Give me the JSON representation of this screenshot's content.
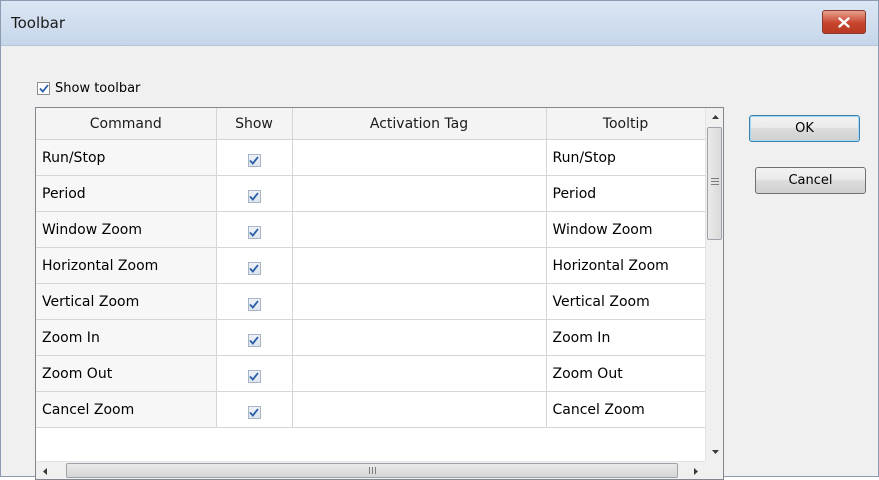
{
  "window": {
    "title": "Toolbar"
  },
  "show_toolbar": {
    "label": "Show toolbar",
    "checked": true
  },
  "grid": {
    "columns": [
      "Command",
      "Show",
      "Activation Tag",
      "Tooltip"
    ],
    "rows": [
      {
        "command": "Run/Stop",
        "show": true,
        "activation_tag": "",
        "tooltip": "Run/Stop"
      },
      {
        "command": "Period",
        "show": true,
        "activation_tag": "",
        "tooltip": "Period"
      },
      {
        "command": "Window Zoom",
        "show": true,
        "activation_tag": "",
        "tooltip": "Window Zoom"
      },
      {
        "command": "Horizontal Zoom",
        "show": true,
        "activation_tag": "",
        "tooltip": "Horizontal Zoom"
      },
      {
        "command": "Vertical Zoom",
        "show": true,
        "activation_tag": "",
        "tooltip": "Vertical Zoom"
      },
      {
        "command": "Zoom In",
        "show": true,
        "activation_tag": "",
        "tooltip": "Zoom In"
      },
      {
        "command": "Zoom Out",
        "show": true,
        "activation_tag": "",
        "tooltip": "Zoom Out"
      },
      {
        "command": "Cancel Zoom",
        "show": true,
        "activation_tag": "",
        "tooltip": "Cancel Zoom"
      }
    ]
  },
  "buttons": {
    "ok": "OK",
    "cancel": "Cancel"
  },
  "icons": {
    "close": "close-icon",
    "scroll_up": "scroll-up-arrow-icon",
    "scroll_down": "scroll-down-arrow-icon",
    "scroll_left": "scroll-left-arrow-icon",
    "scroll_right": "scroll-right-arrow-icon"
  },
  "colors": {
    "title_bar": "#c6d6ea",
    "close_button": "#c7442c",
    "dialog_background": "#f0f0f0",
    "ok_button_focus": "#3c7fb1"
  }
}
